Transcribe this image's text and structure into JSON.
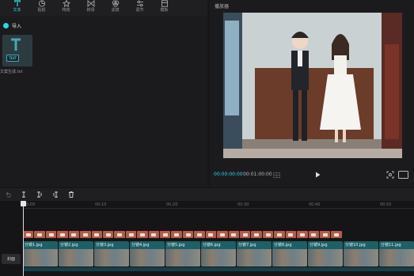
{
  "toolbar": {
    "items": [
      {
        "label": "文本",
        "icon": "text-icon"
      },
      {
        "label": "贴纸",
        "icon": "sticker-icon"
      },
      {
        "label": "特效",
        "icon": "effects-icon"
      },
      {
        "label": "转场",
        "icon": "transition-icon"
      },
      {
        "label": "滤镜",
        "icon": "filter-icon"
      },
      {
        "label": "调节",
        "icon": "adjust-icon"
      },
      {
        "label": "模板",
        "icon": "template-icon"
      }
    ]
  },
  "media": {
    "tab_label": "导入",
    "item_tag": "TEXT",
    "item_name": "文案生成.txt"
  },
  "player": {
    "title": "播放器",
    "time_current": "00:00:00:00",
    "time_total": "00:01:00:00"
  },
  "timeline": {
    "ticks": [
      "00:00",
      "00:10",
      "00:20",
      "00:30",
      "00:40",
      "00:50"
    ],
    "cover_label": "封面",
    "video_clips": [
      "分镜1.jpg",
      "分镜2.jpg",
      "分镜3.jpg",
      "分镜4.jpg",
      "分镜5.jpg",
      "分镜6.jpg",
      "分镜7.jpg",
      "分镜8.jpg",
      "分镜9.jpg",
      "分镜10.jpg",
      "分镜11.jpg"
    ],
    "clip_duration": "00:00"
  },
  "colors": {
    "accent": "#34d3e6",
    "text_track": "#b65a4a",
    "video_track": "#1f5f66"
  }
}
